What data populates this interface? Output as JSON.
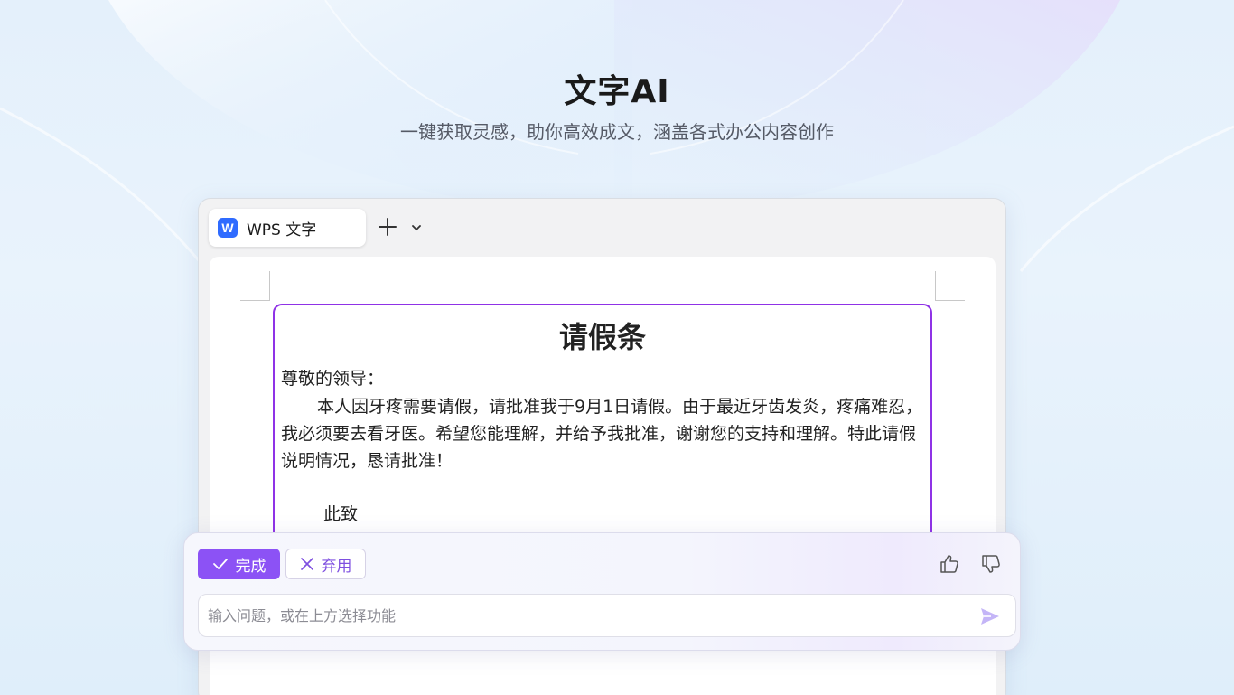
{
  "hero": {
    "title": "文字AI",
    "subtitle": "一键获取灵感，助你高效成文，涵盖各式办公内容创作"
  },
  "app": {
    "tab_logo": "W",
    "tab_label": "WPS 文字",
    "add_tab_icon": "plus-icon",
    "dropdown_icon": "chevron-down-icon"
  },
  "document": {
    "title": "请假条",
    "salutation": "尊敬的领导：",
    "body": "本人因牙疼需要请假，请批准我于9月1日请假。由于最近牙齿发炎，疼痛难忍，我必须要去看牙医。希望您能理解，并给予我批准，谢谢您的支持和理解。特此请假说明情况，恳请批准！",
    "closing": "此致"
  },
  "ai_panel": {
    "done_label": "完成",
    "discard_label": "弃用",
    "prompt_placeholder": "输入问题，或在上方选择功能",
    "prompt_value": "",
    "icons": [
      "check-icon",
      "close-icon",
      "thumbs-up-icon",
      "thumbs-down-icon",
      "send-icon"
    ]
  },
  "colors": {
    "accent": "#8c52f5",
    "ai_border": "#8f32e6",
    "wps_blue": "#2f6bff"
  }
}
